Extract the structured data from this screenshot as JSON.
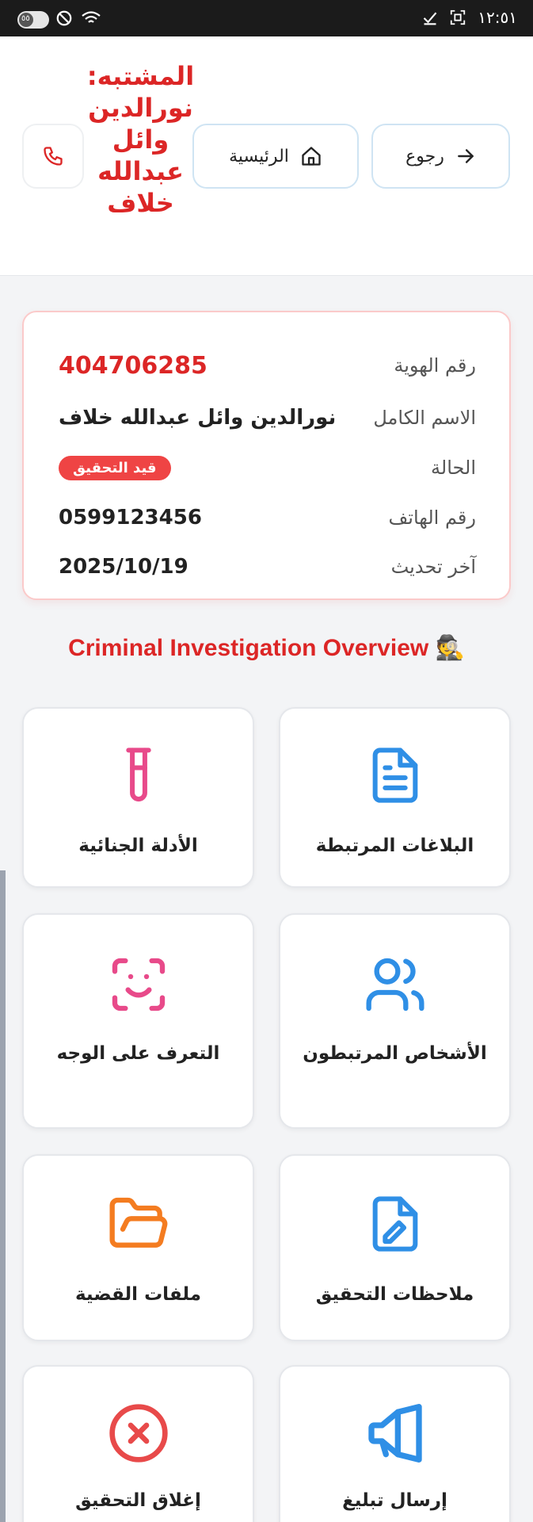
{
  "statusbar": {
    "pill_text": "٥٥",
    "time": "١٢:٥١"
  },
  "header": {
    "back_label": "رجوع",
    "home_label": "الرئيسية",
    "suspect_title": "المشتبه: نورالدين وائل عبدالله خلاف"
  },
  "info": {
    "id_label": "رقم الهوية",
    "id_value": "404706285",
    "name_label": "الاسم الكامل",
    "name_value": "نورالدين وائل عبدالله خلاف",
    "status_label": "الحالة",
    "status_value": "قيد التحقيق",
    "phone_label": "رقم الهاتف",
    "phone_value": "0599123456",
    "updated_label": "آخر تحديث",
    "updated_value": "2025/10/19"
  },
  "section_title": "Criminal Investigation Overview 🕵️",
  "tiles": {
    "reports": "البلاغات المرتبطة",
    "evidence": "الأدلة الجنائية",
    "persons": "الأشخاص المرتبطون",
    "face": "التعرف على الوجه",
    "notes": "ملاحظات التحقيق",
    "files": "ملفات القضية",
    "notify": "إرسال تبليغ",
    "close": "إغلاق التحقيق"
  },
  "colors": {
    "accent_red": "#dc2626",
    "blue": "#2f8fe6",
    "pink": "#e84a8a",
    "orange": "#f47c20"
  }
}
